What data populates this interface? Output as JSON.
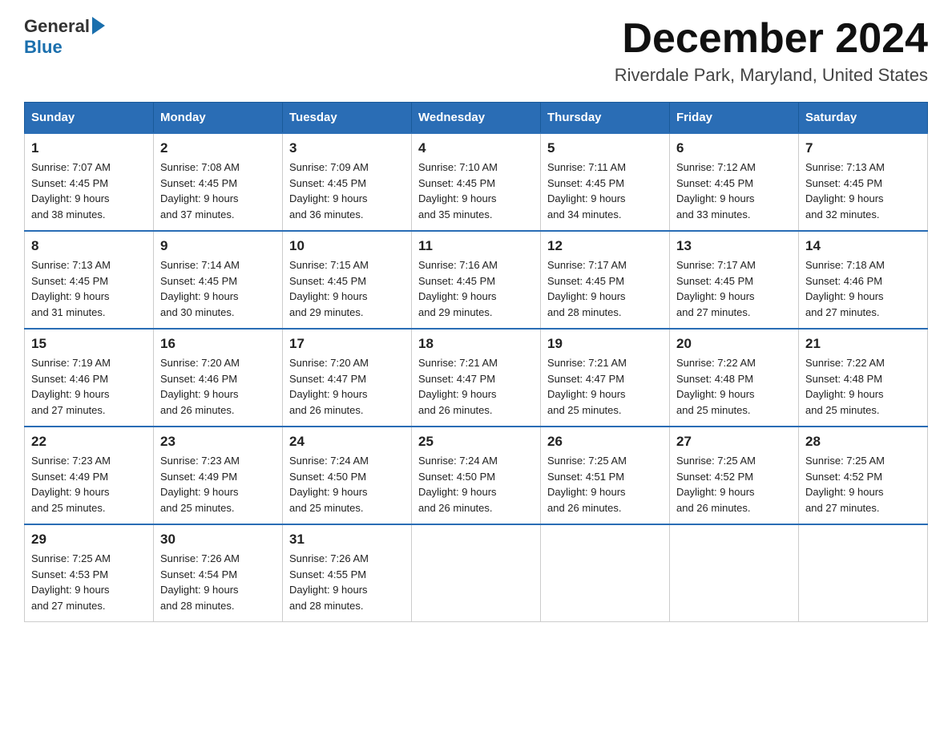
{
  "header": {
    "logo_general": "General",
    "logo_blue": "Blue",
    "month_title": "December 2024",
    "location": "Riverdale Park, Maryland, United States"
  },
  "days_of_week": [
    "Sunday",
    "Monday",
    "Tuesday",
    "Wednesday",
    "Thursday",
    "Friday",
    "Saturday"
  ],
  "weeks": [
    [
      {
        "day": "1",
        "sunrise": "7:07 AM",
        "sunset": "4:45 PM",
        "daylight": "9 hours and 38 minutes."
      },
      {
        "day": "2",
        "sunrise": "7:08 AM",
        "sunset": "4:45 PM",
        "daylight": "9 hours and 37 minutes."
      },
      {
        "day": "3",
        "sunrise": "7:09 AM",
        "sunset": "4:45 PM",
        "daylight": "9 hours and 36 minutes."
      },
      {
        "day": "4",
        "sunrise": "7:10 AM",
        "sunset": "4:45 PM",
        "daylight": "9 hours and 35 minutes."
      },
      {
        "day": "5",
        "sunrise": "7:11 AM",
        "sunset": "4:45 PM",
        "daylight": "9 hours and 34 minutes."
      },
      {
        "day": "6",
        "sunrise": "7:12 AM",
        "sunset": "4:45 PM",
        "daylight": "9 hours and 33 minutes."
      },
      {
        "day": "7",
        "sunrise": "7:13 AM",
        "sunset": "4:45 PM",
        "daylight": "9 hours and 32 minutes."
      }
    ],
    [
      {
        "day": "8",
        "sunrise": "7:13 AM",
        "sunset": "4:45 PM",
        "daylight": "9 hours and 31 minutes."
      },
      {
        "day": "9",
        "sunrise": "7:14 AM",
        "sunset": "4:45 PM",
        "daylight": "9 hours and 30 minutes."
      },
      {
        "day": "10",
        "sunrise": "7:15 AM",
        "sunset": "4:45 PM",
        "daylight": "9 hours and 29 minutes."
      },
      {
        "day": "11",
        "sunrise": "7:16 AM",
        "sunset": "4:45 PM",
        "daylight": "9 hours and 29 minutes."
      },
      {
        "day": "12",
        "sunrise": "7:17 AM",
        "sunset": "4:45 PM",
        "daylight": "9 hours and 28 minutes."
      },
      {
        "day": "13",
        "sunrise": "7:17 AM",
        "sunset": "4:45 PM",
        "daylight": "9 hours and 27 minutes."
      },
      {
        "day": "14",
        "sunrise": "7:18 AM",
        "sunset": "4:46 PM",
        "daylight": "9 hours and 27 minutes."
      }
    ],
    [
      {
        "day": "15",
        "sunrise": "7:19 AM",
        "sunset": "4:46 PM",
        "daylight": "9 hours and 27 minutes."
      },
      {
        "day": "16",
        "sunrise": "7:20 AM",
        "sunset": "4:46 PM",
        "daylight": "9 hours and 26 minutes."
      },
      {
        "day": "17",
        "sunrise": "7:20 AM",
        "sunset": "4:47 PM",
        "daylight": "9 hours and 26 minutes."
      },
      {
        "day": "18",
        "sunrise": "7:21 AM",
        "sunset": "4:47 PM",
        "daylight": "9 hours and 26 minutes."
      },
      {
        "day": "19",
        "sunrise": "7:21 AM",
        "sunset": "4:47 PM",
        "daylight": "9 hours and 25 minutes."
      },
      {
        "day": "20",
        "sunrise": "7:22 AM",
        "sunset": "4:48 PM",
        "daylight": "9 hours and 25 minutes."
      },
      {
        "day": "21",
        "sunrise": "7:22 AM",
        "sunset": "4:48 PM",
        "daylight": "9 hours and 25 minutes."
      }
    ],
    [
      {
        "day": "22",
        "sunrise": "7:23 AM",
        "sunset": "4:49 PM",
        "daylight": "9 hours and 25 minutes."
      },
      {
        "day": "23",
        "sunrise": "7:23 AM",
        "sunset": "4:49 PM",
        "daylight": "9 hours and 25 minutes."
      },
      {
        "day": "24",
        "sunrise": "7:24 AM",
        "sunset": "4:50 PM",
        "daylight": "9 hours and 25 minutes."
      },
      {
        "day": "25",
        "sunrise": "7:24 AM",
        "sunset": "4:50 PM",
        "daylight": "9 hours and 26 minutes."
      },
      {
        "day": "26",
        "sunrise": "7:25 AM",
        "sunset": "4:51 PM",
        "daylight": "9 hours and 26 minutes."
      },
      {
        "day": "27",
        "sunrise": "7:25 AM",
        "sunset": "4:52 PM",
        "daylight": "9 hours and 26 minutes."
      },
      {
        "day": "28",
        "sunrise": "7:25 AM",
        "sunset": "4:52 PM",
        "daylight": "9 hours and 27 minutes."
      }
    ],
    [
      {
        "day": "29",
        "sunrise": "7:25 AM",
        "sunset": "4:53 PM",
        "daylight": "9 hours and 27 minutes."
      },
      {
        "day": "30",
        "sunrise": "7:26 AM",
        "sunset": "4:54 PM",
        "daylight": "9 hours and 28 minutes."
      },
      {
        "day": "31",
        "sunrise": "7:26 AM",
        "sunset": "4:55 PM",
        "daylight": "9 hours and 28 minutes."
      },
      null,
      null,
      null,
      null
    ]
  ],
  "labels": {
    "sunrise_prefix": "Sunrise: ",
    "sunset_prefix": "Sunset: ",
    "daylight_prefix": "Daylight: "
  }
}
